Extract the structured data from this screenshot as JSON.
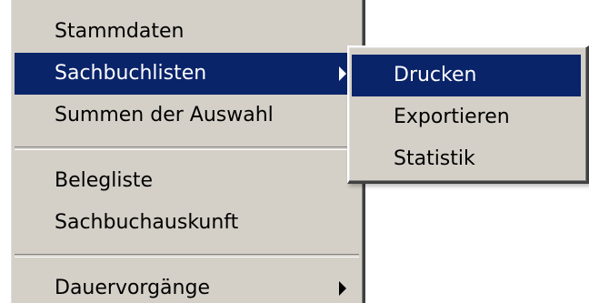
{
  "main_menu": {
    "items": [
      {
        "label": "Stammdaten"
      },
      {
        "label": "Sachbuchlisten",
        "has_submenu": true,
        "highlighted": true
      },
      {
        "label": "Summen der Auswahl"
      },
      {
        "label": "Belegliste"
      },
      {
        "label": "Sachbuchauskunft"
      },
      {
        "label": "Dauervorgänge",
        "has_submenu": true
      }
    ]
  },
  "sub_menu": {
    "items": [
      {
        "label": "Drucken",
        "highlighted": true
      },
      {
        "label": "Exportieren"
      },
      {
        "label": "Statistik"
      }
    ]
  },
  "colors": {
    "menu_background": "#d4d0c8",
    "highlight_background": "#0a246a",
    "highlight_text": "#ffffff"
  },
  "icons": [
    "submenu-arrow-icon"
  ]
}
